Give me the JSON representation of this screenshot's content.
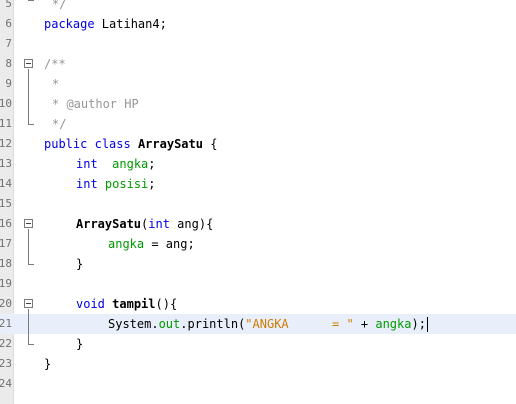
{
  "line_numbers": [
    "5",
    "6",
    "7",
    "8",
    "9",
    "10",
    "11",
    "12",
    "13",
    "14",
    "15",
    "16",
    "17",
    "18",
    "19",
    "20",
    "21",
    "22",
    "23",
    "24"
  ],
  "code": {
    "l5": "*/",
    "l6_kw": "package",
    "l6_rest": " Latihan4;",
    "l8": "/**",
    "l9": "*",
    "l10": "* @author HP",
    "l11": "*/",
    "l12_kw1": "public",
    "l12_kw2": "class",
    "l12_name": "ArraySatu",
    "l12_rest": " {",
    "l13_kw": "int",
    "l13_fd": "angka",
    "l13_rest": ";",
    "l14_kw": "int",
    "l14_fd": "posisi",
    "l14_rest": ";",
    "l16_name": "ArraySatu",
    "l16_p1": "(",
    "l16_kw": "int",
    "l16_rest": " ang){",
    "l17_fd": "angka",
    "l17_rest": " = ang;",
    "l18": "}",
    "l20_kw": "void",
    "l20_name": "tampil",
    "l20_rest": "(){",
    "l21_a": "System.",
    "l21_fd": "out",
    "l21_b": ".println(",
    "l21_str": "\"ANGKA      = \"",
    "l21_c": " + ",
    "l21_fd2": "angka",
    "l21_d": ");",
    "l22": "}",
    "l23": "}"
  }
}
